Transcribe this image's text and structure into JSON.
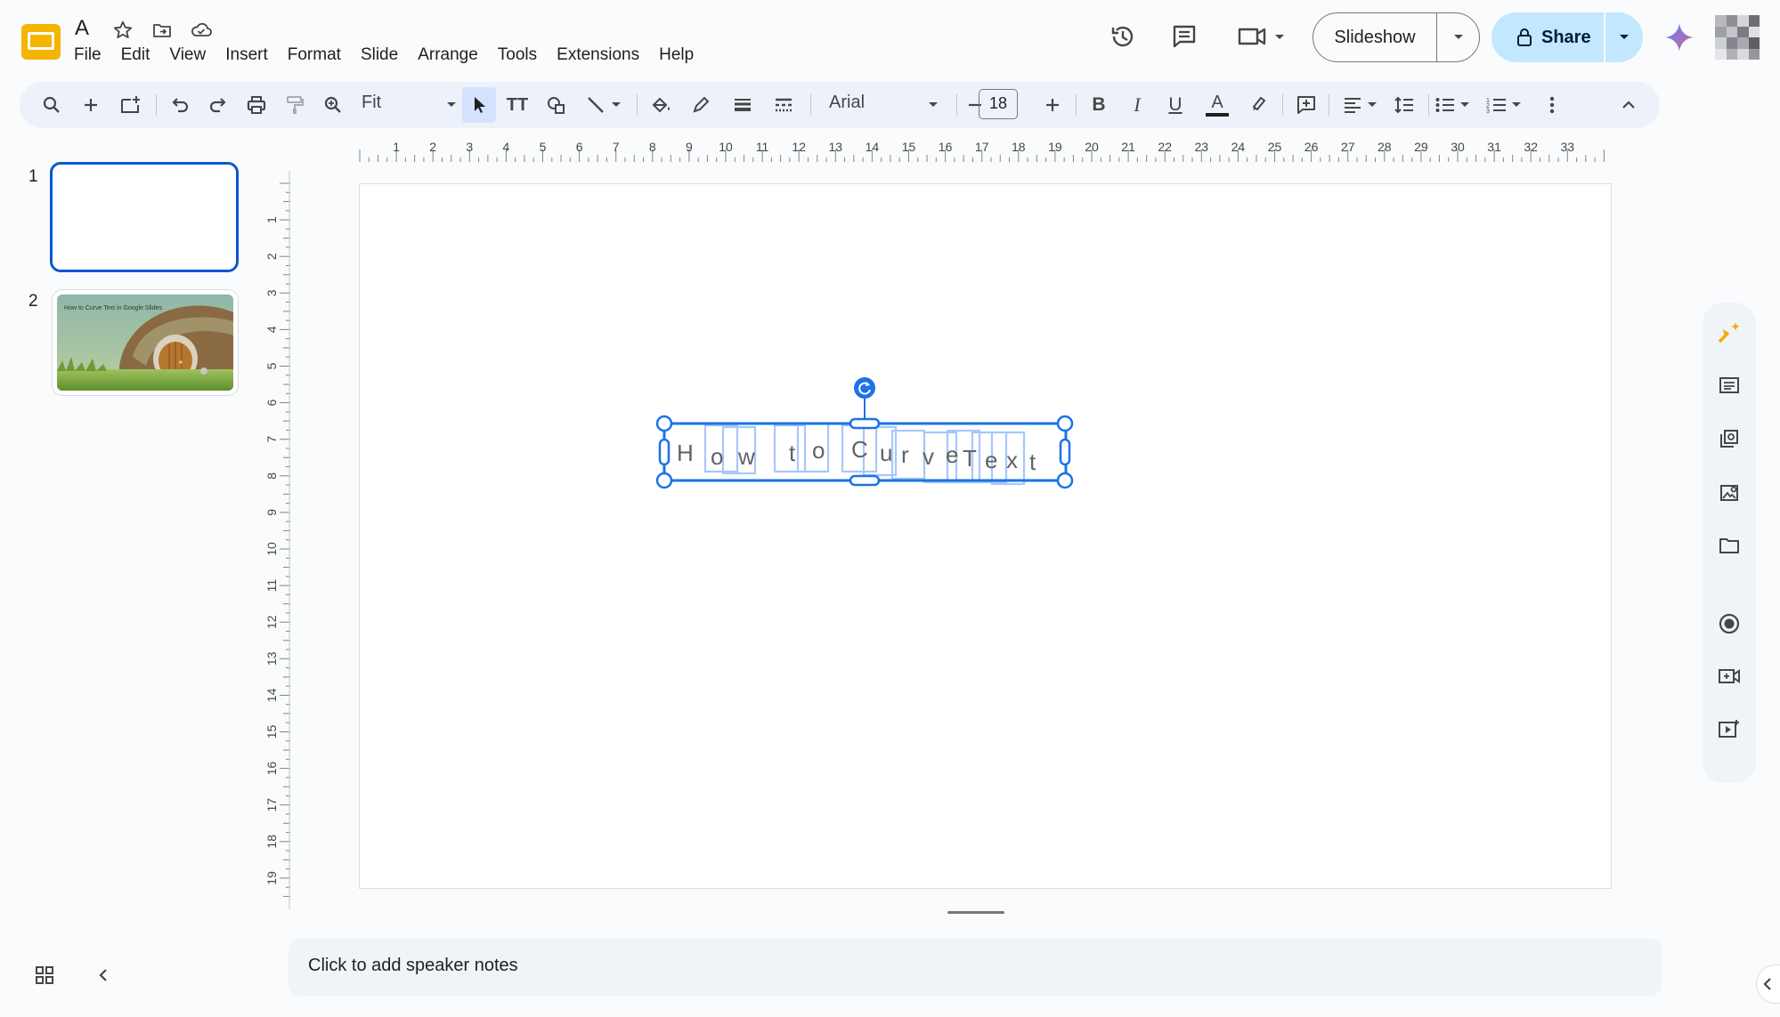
{
  "app": {
    "doc_title": "A",
    "icons": [
      "slides-logo",
      "star-icon",
      "move-to-folder-icon",
      "cloud-saved-icon"
    ]
  },
  "menu": [
    "File",
    "Edit",
    "View",
    "Insert",
    "Format",
    "Slide",
    "Arrange",
    "Tools",
    "Extensions",
    "Help"
  ],
  "header": {
    "slideshow_label": "Slideshow",
    "share_label": "Share",
    "icons": [
      "history-icon",
      "comment-icon",
      "meet-camera-icon",
      "gemini-icon",
      "avatar"
    ]
  },
  "toolbar": {
    "zoom_value": "Fit",
    "font_family": "Arial",
    "font_size": "18",
    "bold_label": "B",
    "italic_label": "I",
    "underline_label": "U",
    "text_color_label": "A",
    "text_tool_label": "TT"
  },
  "filmstrip": {
    "slides": [
      {
        "number": "1",
        "selected": true
      },
      {
        "number": "2",
        "title": "How to Curve Text in Google Slides"
      }
    ]
  },
  "rulers": {
    "horizontal": [
      "1",
      "2",
      "3",
      "4",
      "5",
      "6",
      "7",
      "8",
      "9",
      "10",
      "11",
      "12",
      "13",
      "14",
      "15",
      "16",
      "17",
      "18",
      "19",
      "20",
      "21",
      "22",
      "23",
      "24",
      "25",
      "26",
      "27",
      "28",
      "29",
      "30",
      "31",
      "32",
      "33"
    ],
    "vertical": [
      "1",
      "2",
      "3",
      "4",
      "5",
      "6",
      "7",
      "8",
      "9",
      "10",
      "11",
      "12",
      "13",
      "14",
      "15",
      "16",
      "17",
      "18",
      "19"
    ]
  },
  "canvas": {
    "curved_text": [
      "H",
      "o",
      "w",
      " ",
      "t",
      "o",
      " ",
      "C",
      "u",
      "r",
      "v",
      "e",
      " ",
      "T",
      "e",
      "x",
      "t"
    ]
  },
  "notes": {
    "placeholder": "Click to add speaker notes"
  },
  "colors": {
    "accent": "#0b57d0",
    "share_bg": "#c2e7ff",
    "toolbar_bg": "#edf2fa",
    "page_bg": "#f9fbfd",
    "logo_yellow": "#f4b400",
    "selection_blue": "#1a73e8"
  }
}
